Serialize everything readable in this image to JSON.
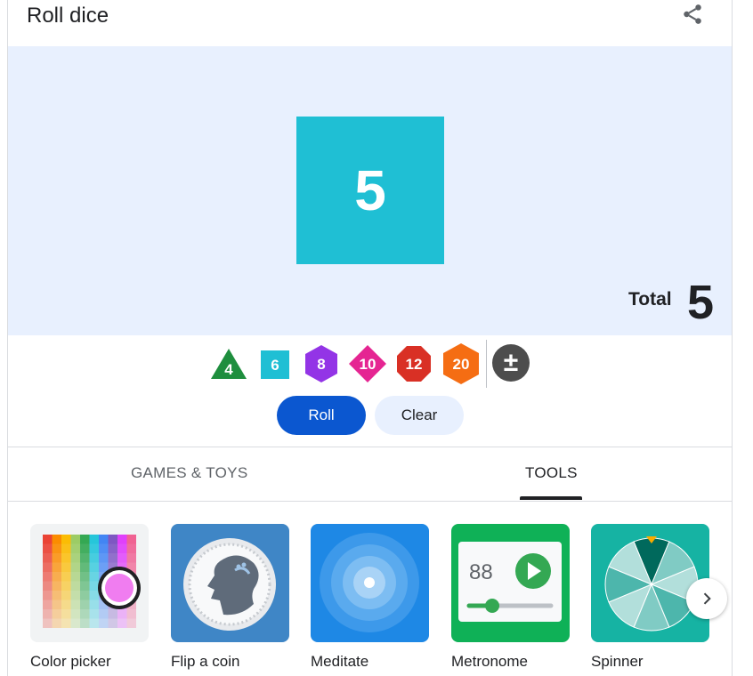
{
  "header": {
    "title": "Roll dice",
    "share_icon": "share-icon"
  },
  "result": {
    "die_value": "5",
    "total_label": "Total",
    "total_value": "5",
    "die_color": "#1fbfd4",
    "stage_color": "#e8f0fe"
  },
  "dice_buttons": [
    {
      "label": "4",
      "shape": "triangle",
      "color": "#1e8e3e"
    },
    {
      "label": "6",
      "shape": "square",
      "color": "#1fbfd4"
    },
    {
      "label": "8",
      "shape": "hexagon",
      "color": "#9334e6"
    },
    {
      "label": "10",
      "shape": "diamond",
      "color": "#e52592"
    },
    {
      "label": "12",
      "shape": "octagon",
      "color": "#d93025"
    },
    {
      "label": "20",
      "shape": "hexagon",
      "color": "#f56d13"
    }
  ],
  "modifier_button": {
    "label": "±",
    "color": "#4d4d4d"
  },
  "actions": {
    "roll": "Roll",
    "clear": "Clear",
    "roll_color": "#0b57d0"
  },
  "tabs": [
    {
      "label": "GAMES & TOYS",
      "selected": false
    },
    {
      "label": "TOOLS",
      "selected": true
    }
  ],
  "tools": [
    {
      "label": "Color picker",
      "icon": "color-picker-icon"
    },
    {
      "label": "Flip a coin",
      "icon": "coin-icon"
    },
    {
      "label": "Meditate",
      "icon": "meditate-icon"
    },
    {
      "label": "Metronome",
      "icon": "metronome-icon",
      "display": "88"
    },
    {
      "label": "Spinner",
      "icon": "spinner-icon"
    }
  ],
  "carousel": {
    "next_icon": "chevron-right-icon"
  }
}
